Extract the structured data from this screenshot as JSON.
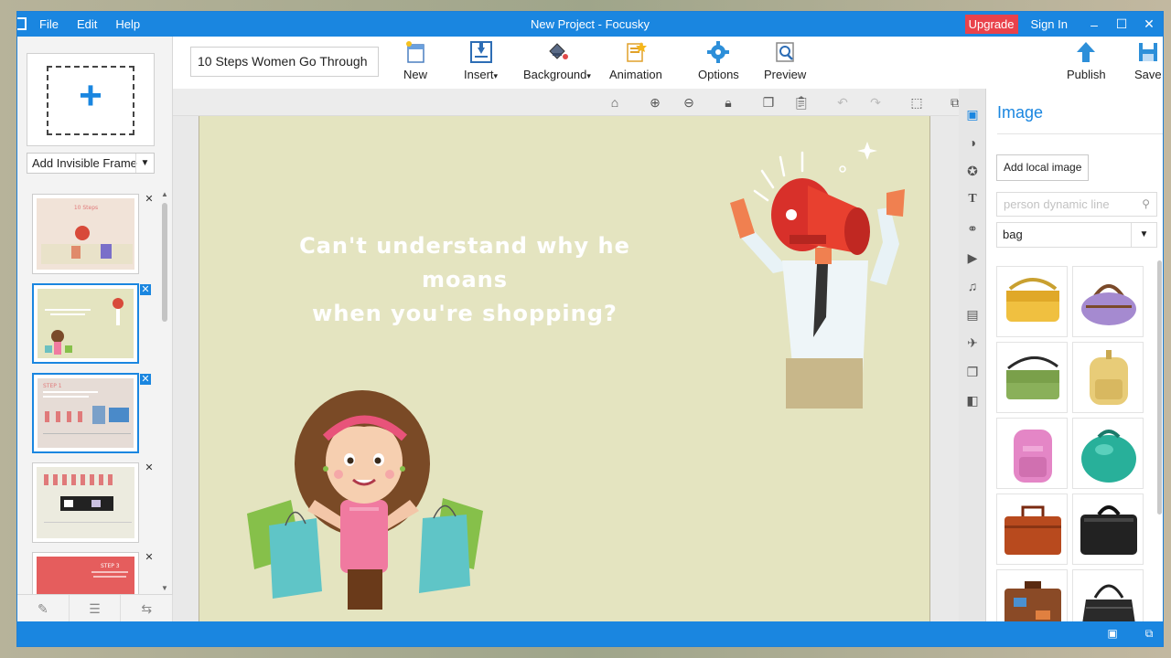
{
  "window": {
    "menu": [
      "File",
      "Edit",
      "Help"
    ],
    "title": "New Project - Focusky",
    "upgrade": "Upgrade",
    "sign_in": "Sign In",
    "controls": [
      "–",
      "☐",
      "✕"
    ]
  },
  "toolbar": {
    "project_name": "10 Steps Women Go Through",
    "new": "New",
    "insert": "Insert",
    "background": "Background",
    "animation": "Animation",
    "options": "Options",
    "preview": "Preview",
    "publish": "Publish",
    "save": "Save",
    "dropdown_arrow": "▾"
  },
  "left_panel": {
    "frame_type": "Add Invisible Frame",
    "thumb_texts": [
      "10 Steps",
      "STEP 1",
      "STEP 3"
    ]
  },
  "slide": {
    "line1": "Can't understand why he moans",
    "line2": "when you're shopping?"
  },
  "right_panel": {
    "title": "Image",
    "add_local_image": "Add local image",
    "search_placeholder": "person dynamic line",
    "category": "bag",
    "images": [
      "yellow-bag",
      "purple-duffel-bag",
      "green-messenger-bag",
      "yellow-backpack",
      "pink-backpack",
      "teal-suitcase",
      "brown-briefcase",
      "black-briefcase",
      "travel-suitcase",
      "black-handbag"
    ]
  },
  "colors": {
    "accent": "#1a86e0",
    "upgrade": "#e9424b",
    "slide_bg": "#e4e4c0"
  }
}
